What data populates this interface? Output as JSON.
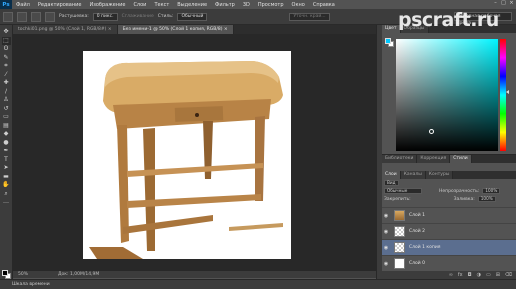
{
  "app": {
    "logo": "Ps"
  },
  "menu": [
    "Файл",
    "Редактирование",
    "Изображение",
    "Слои",
    "Текст",
    "Выделение",
    "Фильтр",
    "3D",
    "Просмотр",
    "Окно",
    "Справка"
  ],
  "options": {
    "feather_label": "Растушевка:",
    "feather_value": "0 пикс.",
    "antialias": "Сглаживание",
    "style_label": "Стиль:",
    "style_value": "Обычный",
    "refine": "Уточн. край...",
    "workspace": "Основная рабочая среда"
  },
  "tabs": [
    {
      "label": "tochki01.png @ 50% (Слой 1, RGB/8#) ×",
      "active": false
    },
    {
      "label": "Без имени-1 @ 50% (Слой 1 копия, RGB/8) × ",
      "active": true
    }
  ],
  "status": {
    "zoom": "50%",
    "doc": "Док: 1,00M/14,9M"
  },
  "timeline_label": "Шкала времени",
  "color_panel": {
    "tabs": [
      "Цвет",
      "Образцы"
    ],
    "fg": "#00c8ff"
  },
  "layers_panel": {
    "top_tabs": [
      "Библиотеки",
      "Коррекция",
      "Стили"
    ],
    "sub_tabs": [
      "Слои",
      "Каналы",
      "Контуры"
    ],
    "kind_label": "Вид",
    "blend_mode": "Обычные",
    "opacity_label": "Непрозрачность:",
    "opacity_value": "100%",
    "lock_label": "Закрепить:",
    "fill_label": "Заливка:",
    "fill_value": "100%",
    "layers": [
      {
        "name": "Слой 1",
        "thumb": "img",
        "selected": false
      },
      {
        "name": "Слой 2",
        "thumb": "transparent",
        "selected": false
      },
      {
        "name": "Слой 1 копия",
        "thumb": "transparent",
        "selected": true
      },
      {
        "name": "Слой 0",
        "thumb": "white",
        "selected": false
      }
    ]
  },
  "watermark": "pscraft.ru",
  "colors": {
    "selected_layer": "#5b6e8f",
    "table_wood": "#c89a58"
  }
}
